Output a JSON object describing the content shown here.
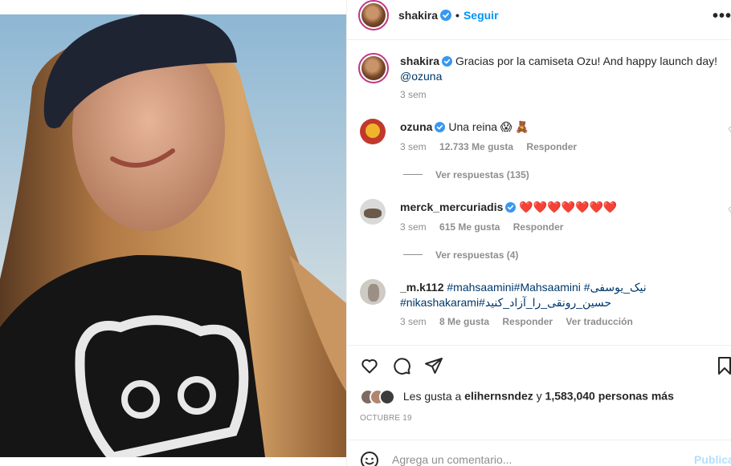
{
  "post": {
    "username": "shakira",
    "follow_label": "Seguir",
    "more_label": "•••"
  },
  "caption": {
    "username": "shakira",
    "text": "Gracias por la camiseta Ozu! And happy launch day!",
    "mention": "@ozuna",
    "time": "3 sem"
  },
  "comments": [
    {
      "username": "ozuna",
      "text": "Una reina 😱 🧸",
      "time": "3 sem",
      "likes": "12.733 Me gusta",
      "reply_label": "Responder",
      "view_replies": "Ver respuestas (135)"
    },
    {
      "username": "merck_mercuriadis",
      "text": "❤️❤️❤️❤️❤️❤️❤️",
      "time": "3 sem",
      "likes": "615 Me gusta",
      "reply_label": "Responder",
      "view_replies": "Ver respuestas (4)"
    },
    {
      "username": "_m.k112",
      "text_line1": "#mahsaamini#Mahsaamini #نیک_یوسفی",
      "text_line2": "#nikashakarami#حسین_رونقی_را_آزاد_کنید",
      "time": "3 sem",
      "likes": "8 Me gusta",
      "reply_label": "Responder",
      "translate_label": "Ver traducción"
    }
  ],
  "likes_summary": {
    "prefix": "Les gusta a",
    "user": "elihernsndez",
    "middle": "y",
    "count": "1,583,040 personas más"
  },
  "date": "OCTUBRE 19",
  "add_comment": {
    "placeholder": "Agrega un comentario...",
    "publish_label": "Publica"
  },
  "colors": {
    "accent": "#0095f6",
    "verified": "#3897f0",
    "muted": "#8e8e8e"
  }
}
